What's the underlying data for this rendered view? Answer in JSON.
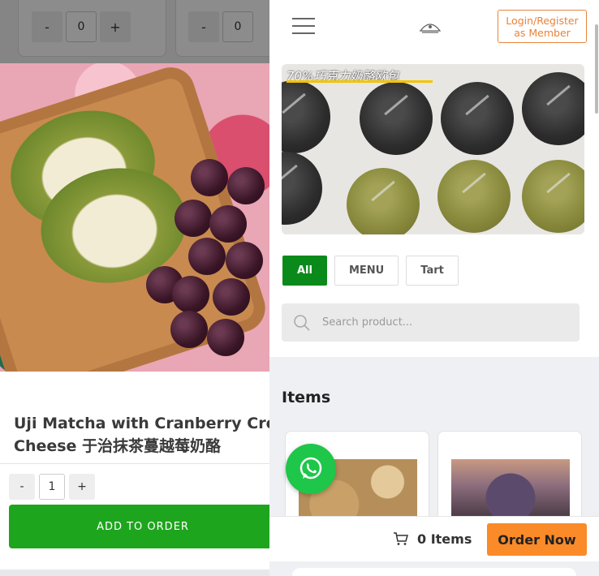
{
  "background": {
    "stepper_left": {
      "minus": "-",
      "value": "0",
      "plus": "+"
    },
    "stepper_right": {
      "minus": "-",
      "value": "0"
    }
  },
  "product": {
    "title_line1": "Uji Matcha with Cranberry Cream",
    "title_line2": "Cheese 于治抹茶蔓越莓奶酪",
    "qty_minus": "-",
    "qty_value": "1",
    "qty_plus": "+",
    "add_label": "ADD TO ORDER"
  },
  "header": {
    "menu_icon": "hamburger-menu-icon",
    "logo_icon": "bakery-logo-icon",
    "login_line1": "Login/Register",
    "login_line2": "as Member",
    "accent": "#e8833a"
  },
  "banner": {
    "overlay_text": "70%巧克力奶酪欧包"
  },
  "filters": [
    {
      "label": "All",
      "active": true
    },
    {
      "label": "MENU",
      "active": false
    },
    {
      "label": "Tart",
      "active": false
    }
  ],
  "search": {
    "placeholder": "Search product...",
    "icon": "search-icon"
  },
  "items": {
    "title": "Items"
  },
  "cart": {
    "icon": "cart-icon",
    "count_label": "0 Items",
    "order_label": "Order Now",
    "order_color": "#fa8b28"
  },
  "colors": {
    "add_button": "#1ea51e",
    "active_filter": "#0a8a1a",
    "whatsapp": "#1ec64a"
  }
}
